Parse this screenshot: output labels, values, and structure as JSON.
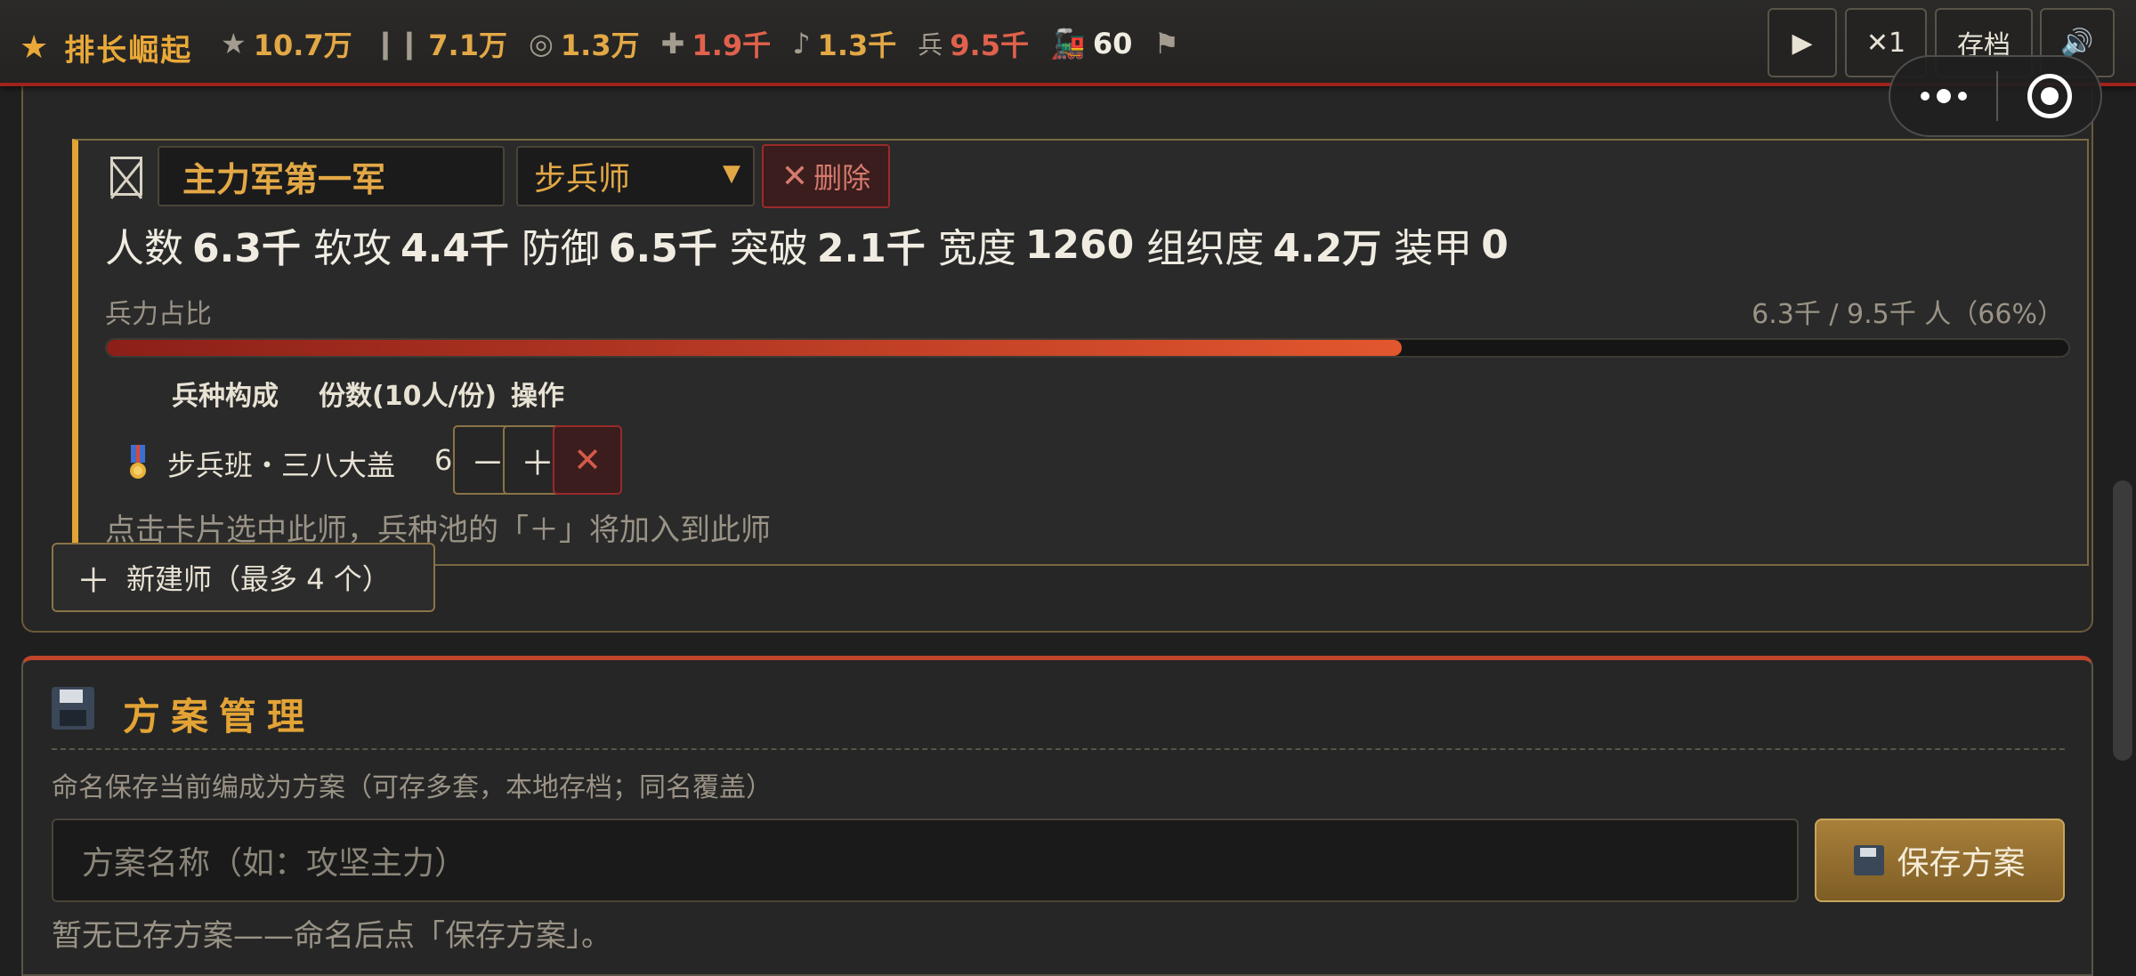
{
  "topbar": {
    "brand_icon": "star-icon",
    "brand": "排长崛起",
    "resources": [
      {
        "icon": "★",
        "value": "10.7万",
        "color": "gold"
      },
      {
        "icon": "❙❙",
        "value": "7.1万",
        "color": "gold"
      },
      {
        "icon": "◎",
        "value": "1.3万",
        "color": "gold"
      },
      {
        "icon": "✚",
        "value": "1.9千",
        "color": "red"
      },
      {
        "icon": "♪",
        "value": "1.3千",
        "color": "gold"
      },
      {
        "icon": "兵",
        "value": "9.5千",
        "color": "red"
      },
      {
        "icon": "🚂",
        "value": "60",
        "color": "white"
      },
      {
        "icon": "⚑",
        "value": "",
        "color": "gray"
      }
    ],
    "play_label": "▶",
    "speed_label": "✕1",
    "save_label": "存档",
    "sound_label": "🔊"
  },
  "division": {
    "name": "主力军第一军",
    "type": "步兵师",
    "delete_label": "删除",
    "stats": [
      {
        "label": "人数",
        "value": "6.3千"
      },
      {
        "label": "软攻",
        "value": "4.4千"
      },
      {
        "label": "防御",
        "value": "6.5千"
      },
      {
        "label": "突破",
        "value": "2.1千"
      },
      {
        "label": "宽度",
        "value": "1260"
      },
      {
        "label": "组织度",
        "value": "4.2万"
      },
      {
        "label": "装甲",
        "value": "0"
      }
    ],
    "share_label": "兵力占比",
    "share_value": "6.3千 / 9.5千 人（66%）",
    "share_fraction": 0.66,
    "table": {
      "headers": [
        "兵种构成",
        "份数(10人/份)",
        "操作"
      ],
      "rows": [
        {
          "icon": "medal-icon",
          "name": "步兵班・三八大盖",
          "count": "630"
        }
      ],
      "minus_label": "－",
      "plus_label": "＋",
      "remove_label": "✕"
    },
    "hint": "点击卡片选中此师，兵种池的「＋」将加入到此师"
  },
  "new_division_label": "新建师（最多 4 个）",
  "plan": {
    "title": "方案管理",
    "desc": "命名保存当前编成为方案（可存多套，本地存档；同名覆盖）",
    "input_placeholder": "方案名称（如：攻坚主力）",
    "save_label": "保存方案",
    "empty_text": "暂无已存方案——命名后点「保存方案」。"
  },
  "colors": {
    "accent_gold": "#e3a335",
    "accent_red": "#a0221c",
    "danger": "#9a2a2a"
  }
}
